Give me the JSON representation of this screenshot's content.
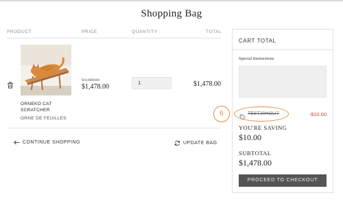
{
  "page": {
    "title": "Shopping Bag"
  },
  "table": {
    "headers": {
      "product": "PRODUCT",
      "price": "PRICE",
      "quantity": "QUANTITY",
      "total": "TOTAL"
    }
  },
  "item": {
    "name": "ORNEKO CAT SCRATCHER",
    "vendor": "ORNE DE FEUILLES",
    "compare_price": "$1,488.00",
    "price": "$1,478.00",
    "quantity": "1",
    "line_total": "$1,478.00",
    "image": "cat-lying-on-scratcher"
  },
  "actions": {
    "continue_label": "CONTINUE SHOPPING",
    "update_label": "UPDATE BAG"
  },
  "cart": {
    "title": "CART TOTAL",
    "instructions_label": "Special Instructions",
    "discount_code": "TEST20HOLI7",
    "discount_amount": "-$10.00",
    "saving_label": "YOU'RE SAVING",
    "saving_value": "$10.00",
    "subtotal_label": "SUBTOTAL",
    "subtotal_value": "$1,478.00",
    "checkout_label": "PROCEED TO CHECKOUT"
  },
  "annotation": {
    "step_number": "6"
  },
  "colors": {
    "accent": "#e98a3c",
    "discount": "#d0492b",
    "button": "#555555"
  },
  "icons": {
    "trash": "trash-icon",
    "arrow_left": "arrow-left-icon",
    "refresh": "refresh-icon",
    "tag": "tag-icon"
  }
}
